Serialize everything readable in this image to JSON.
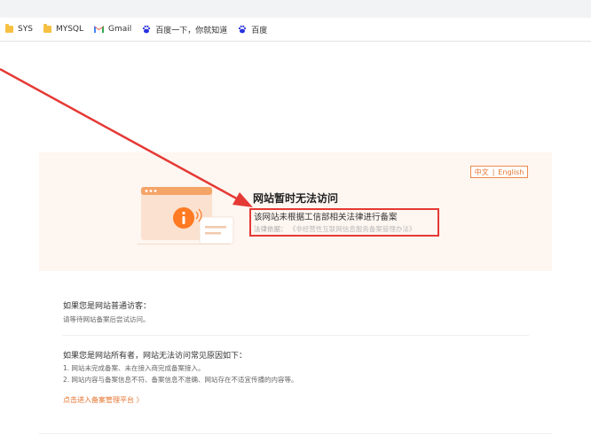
{
  "bookmarks": [
    {
      "label": "SYS",
      "icon": "folder-icon"
    },
    {
      "label": "MYSQL",
      "icon": "folder-icon"
    },
    {
      "label": "Gmail",
      "icon": "gmail-icon"
    },
    {
      "label": "百度一下，你就知道",
      "icon": "baidu-icon"
    },
    {
      "label": "百度",
      "icon": "baidu-icon"
    }
  ],
  "lang": {
    "zh": "中文",
    "sep": "|",
    "en": "English"
  },
  "notice": {
    "title": "网站暂时无法访问",
    "subtitle": "该网站未根据工信部相关法律进行备案",
    "basis_label": "法律依据：",
    "basis_link": "《非经营性互联网信息服务备案管理办法》"
  },
  "visitor": {
    "heading": "如果您是网站普通访客：",
    "text": "请等待网站备案后尝试访问。"
  },
  "owner": {
    "heading": "如果您是网站所有者，网站无法访问常见原因如下：",
    "reasons": [
      "1. 网站未完成备案、未在接入商完成备案接入。",
      "2. 网站内容与备案信息不符、备案信息不准确、网站存在不适宜传播的内容等。"
    ],
    "cta": "点击进入备案管理平台 〉"
  },
  "colors": {
    "accent": "#e5732e",
    "annotation": "#e53935"
  }
}
